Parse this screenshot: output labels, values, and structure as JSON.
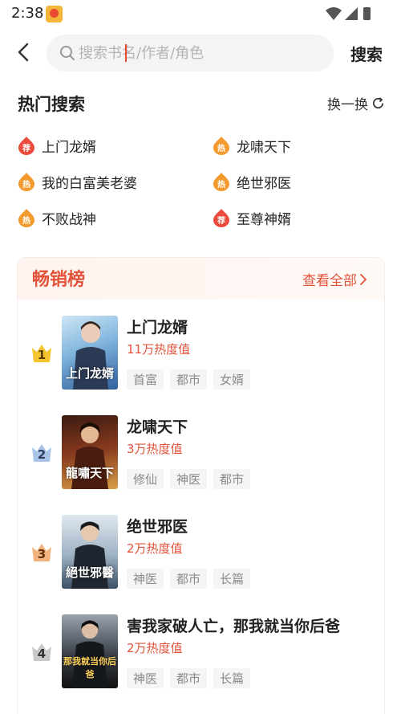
{
  "status": {
    "time": "2:38"
  },
  "search": {
    "placeholder": "搜索书名/作者/角色",
    "submit_label": "搜索"
  },
  "hot_search": {
    "title": "热门搜索",
    "refresh_label": "换一换",
    "items": [
      {
        "label": "上门龙婿",
        "badge": "荐"
      },
      {
        "label": "龙啸天下",
        "badge": "热"
      },
      {
        "label": "我的白富美老婆",
        "badge": "热"
      },
      {
        "label": "绝世邪医",
        "badge": "热"
      },
      {
        "label": "不败战神",
        "badge": "热"
      },
      {
        "label": "至尊神婿",
        "badge": "荐"
      }
    ]
  },
  "bestseller": {
    "title": "畅销榜",
    "more_label": "查看全部",
    "books": [
      {
        "rank": "1",
        "title": "上门龙婿",
        "heat": "11万热度值",
        "cover_text": "上门龙婿",
        "tags": [
          "首富",
          "都市",
          "女婿"
        ]
      },
      {
        "rank": "2",
        "title": "龙啸天下",
        "heat": "3万热度值",
        "cover_text": "龍嘯天下",
        "tags": [
          "修仙",
          "神医",
          "都市"
        ]
      },
      {
        "rank": "3",
        "title": "绝世邪医",
        "heat": "2万热度值",
        "cover_text": "絕世邪醫",
        "tags": [
          "神医",
          "都市",
          "长篇"
        ]
      },
      {
        "rank": "4",
        "title": "害我家破人亡，那我就当你后爸",
        "heat": "2万热度值",
        "cover_text": "那我就当你后爸",
        "tags": [
          "神医",
          "都市",
          "长篇"
        ]
      }
    ]
  },
  "colors": {
    "accent": "#e2533a",
    "rank_gold": "#f5c431",
    "rank_silver": "#a9c4e8",
    "rank_bronze": "#f3b37e",
    "rank_plain": "#c9c9c9"
  }
}
